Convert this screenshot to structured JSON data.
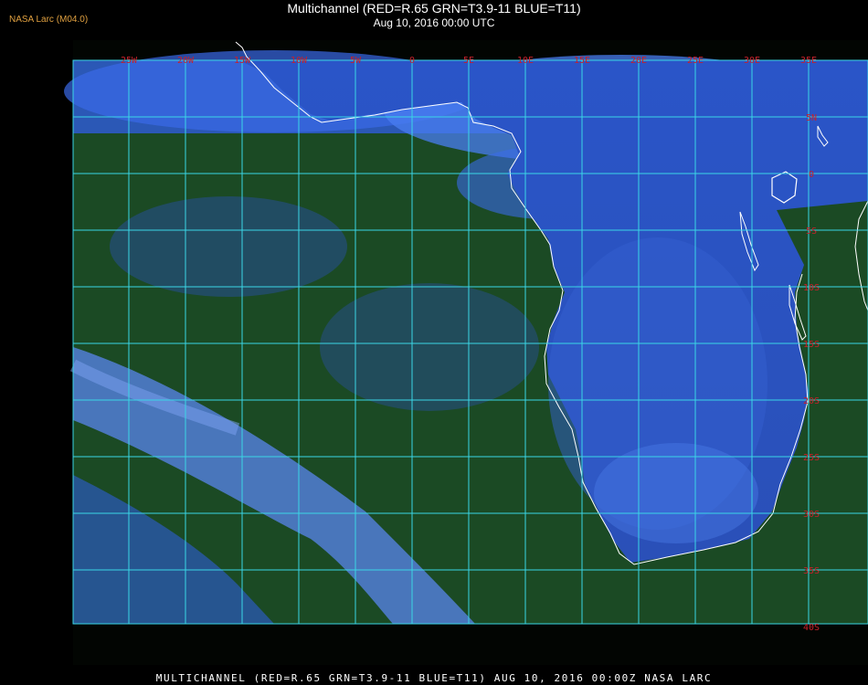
{
  "header": {
    "credit": "NASA Larc (M04.0)",
    "title": "Multichannel (RED=R.65 GRN=T3.9-11 BLUE=T11)",
    "subtitle": "Aug 10, 2016 00:00 UTC"
  },
  "footer": {
    "caption": "MULTICHANNEL (RED=R.65 GRN=T3.9-11 BLUE=T11) AUG 10, 2016 00:00Z  NASA LARC"
  },
  "map": {
    "longitude_labels": [
      "25W",
      "20W",
      "15W",
      "10W",
      "5W",
      "0",
      "5E",
      "10E",
      "15E",
      "20E",
      "25E",
      "30E",
      "35E"
    ],
    "latitude_labels": [
      "5N",
      "0",
      "5S",
      "10S",
      "15S",
      "20S",
      "25S",
      "30S",
      "35S",
      "40S"
    ],
    "colors": {
      "grid": "#3ad6e6",
      "label": "#c8202a",
      "ocean": "#184a22",
      "cloud": "#3a6ae8",
      "coast": "#ffffff"
    }
  }
}
